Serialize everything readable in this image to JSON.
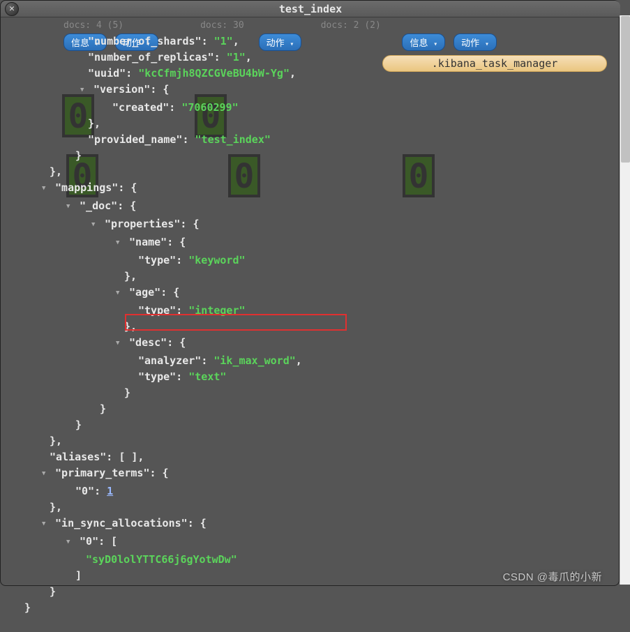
{
  "title": "test_index",
  "close_glyph": "✕",
  "background": {
    "docs_labels": [
      "docs: 4 (5)",
      "docs: 30",
      "docs: 2 (2)"
    ],
    "pill_info": "信息",
    "pill_action": "动作",
    "kibana_label": ".kibana_task_manager",
    "big_zero": "0"
  },
  "json": {
    "number_of_shards_key": "\"number_of_shards\"",
    "number_of_shards_val": "\"1\"",
    "number_of_replicas_key": "\"number_of_replicas\"",
    "number_of_replicas_val": "\"1\"",
    "uuid_key": "\"uuid\"",
    "uuid_val": "\"kcCfmjh8QZCGVeBU4bW-Yg\"",
    "version_key": "\"version\"",
    "created_key": "\"created\"",
    "created_val": "\"7060299\"",
    "provided_name_key": "\"provided_name\"",
    "provided_name_val": "\"test_index\"",
    "mappings_key": "\"mappings\"",
    "doc_key": "\"_doc\"",
    "properties_key": "\"properties\"",
    "name_key": "\"name\"",
    "type_key": "\"type\"",
    "keyword_val": "\"keyword\"",
    "age_key": "\"age\"",
    "integer_val": "\"integer\"",
    "desc_key": "\"desc\"",
    "analyzer_key": "\"analyzer\"",
    "analyzer_val": "\"ik_max_word\"",
    "text_val": "\"text\"",
    "aliases_key": "\"aliases\"",
    "primary_terms_key": "\"primary_terms\"",
    "zero_key": "\"0\"",
    "one_val": "1",
    "in_sync_key": "\"in_sync_allocations\"",
    "sync_id_val": "\"syD0lolYTTC66j6gYotwDw\""
  },
  "watermark": "CSDN @毒爪的小新"
}
